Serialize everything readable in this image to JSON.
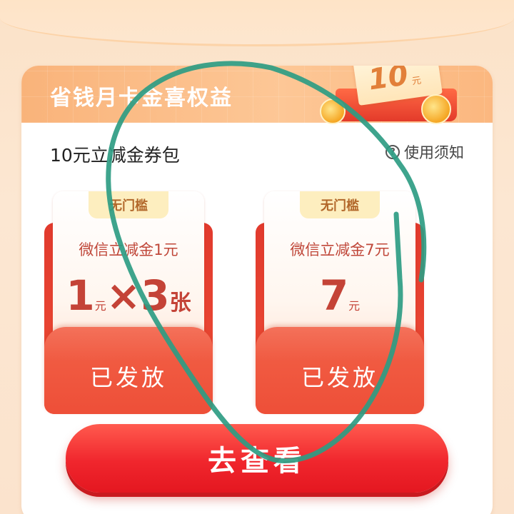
{
  "card": {
    "title": "省钱月卡金喜权益",
    "deco_amount": "10",
    "deco_unit": "元"
  },
  "section": {
    "title": "10元立减金券包",
    "notice": "使用须知"
  },
  "coupons": [
    {
      "badge": "无门槛",
      "name": "微信立减金1元",
      "amount_value": "1",
      "amount_unit": "元",
      "amount_multiplier": "×3",
      "amount_count_unit": "张",
      "status": "已发放"
    },
    {
      "badge": "无门槛",
      "name": "微信立减金7元",
      "amount_value": "7",
      "amount_unit": "元",
      "status": "已发放"
    }
  ],
  "action": {
    "label": "去查看"
  },
  "colors": {
    "accent_red": "#e41720",
    "header_orange": "#fbb77f",
    "badge_cream": "#fdeebf",
    "annotation_green": "#2e9c83"
  }
}
